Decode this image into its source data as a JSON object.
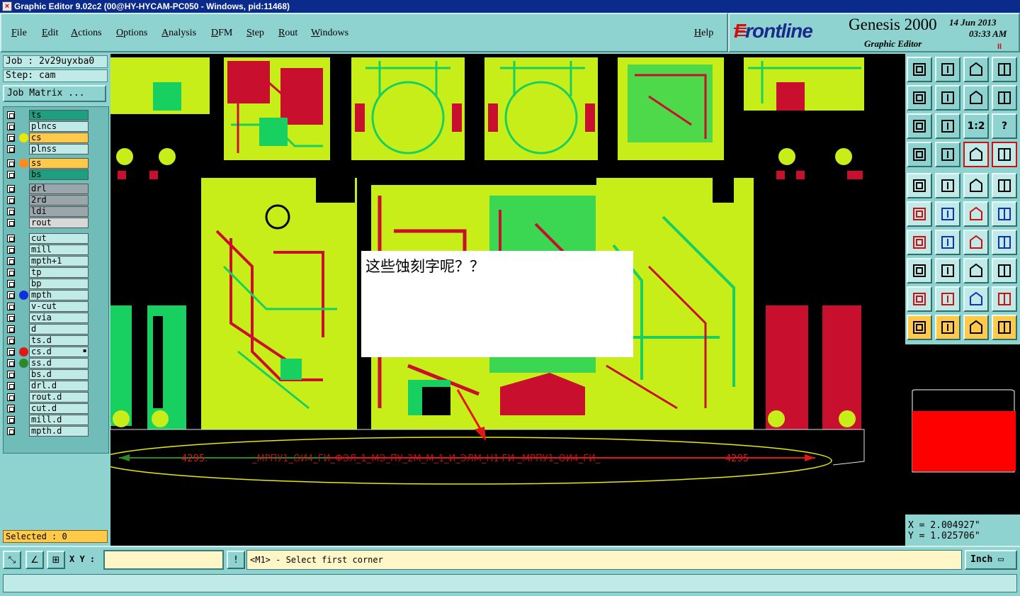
{
  "window": {
    "title": "Graphic Editor 9.02c2 (00@HY-HYCAM-PC050 - Windows, pid:11468)"
  },
  "menu": [
    "File",
    "Edit",
    "Actions",
    "Options",
    "Analysis",
    "DFM",
    "Step",
    "Rout",
    "Windows"
  ],
  "help_label": "Help",
  "brand": {
    "logo": "Frontline",
    "product": "Genesis 2000",
    "subtitle": "Graphic Editor",
    "date": "14 Jun 2013",
    "time": "03:33 AM",
    "pause": "II"
  },
  "job": {
    "job_label": "Job : 2v29uyxba0",
    "step_label": "Step: cam",
    "matrix_button": "Job Matrix ..."
  },
  "layers": [
    {
      "name": "ts",
      "color": "#1f9f82",
      "dot": ""
    },
    {
      "name": "plncs",
      "color": "#bfeae8",
      "dot": ""
    },
    {
      "name": "cs",
      "color": "#ffc94a",
      "dot": "#e8e800"
    },
    {
      "name": "plnss",
      "color": "#bfeae8",
      "dot": ""
    },
    {
      "name": "ss",
      "color": "#ffc94a",
      "dot": "#ff8c1a"
    },
    {
      "name": "bs",
      "color": "#1f9f82",
      "dot": ""
    },
    {
      "name": "drl",
      "color": "#9aa6ac",
      "dot": ""
    },
    {
      "name": "2rd",
      "color": "#9aa6ac",
      "dot": ""
    },
    {
      "name": "ldi",
      "color": "#9aa6ac",
      "dot": ""
    },
    {
      "name": "rout",
      "color": "#d8d8d8",
      "dot": ""
    },
    {
      "name": "cut",
      "color": "#bfeae8",
      "dot": ""
    },
    {
      "name": "mill",
      "color": "#bfeae8",
      "dot": ""
    },
    {
      "name": "mpth+1",
      "color": "#bfeae8",
      "dot": ""
    },
    {
      "name": "tp",
      "color": "#bfeae8",
      "dot": ""
    },
    {
      "name": "bp",
      "color": "#bfeae8",
      "dot": ""
    },
    {
      "name": "mpth",
      "color": "#bfeae8",
      "dot": "#1030e0"
    },
    {
      "name": "v-cut",
      "color": "#bfeae8",
      "dot": ""
    },
    {
      "name": "cvia",
      "color": "#bfeae8",
      "dot": ""
    },
    {
      "name": "d",
      "color": "#bfeae8",
      "dot": ""
    },
    {
      "name": "ts.d",
      "color": "#bfeae8",
      "dot": ""
    },
    {
      "name": "cs.d",
      "color": "#bfeae8",
      "dot": "#e01818",
      "extra": "▪"
    },
    {
      "name": "ss.d",
      "color": "#bfeae8",
      "dot": "#2a8a2a"
    },
    {
      "name": "bs.d",
      "color": "#bfeae8",
      "dot": ""
    },
    {
      "name": "drl.d",
      "color": "#bfeae8",
      "dot": ""
    },
    {
      "name": "rout.d",
      "color": "#bfeae8",
      "dot": ""
    },
    {
      "name": "cut.d",
      "color": "#bfeae8",
      "dot": ""
    },
    {
      "name": "mill.d",
      "color": "#bfeae8",
      "dot": ""
    },
    {
      "name": "mpth.d",
      "color": "#bfeae8",
      "dot": ""
    }
  ],
  "selected_label": "Selected : 0",
  "canvas": {
    "callout_text": "这些蚀刻字呢？？",
    "etched_left": "4295.",
    "etched_right": "4295",
    "etched_mid": "_МРПУ1_ОИ4_ГИ_ФЭЛ_1_МЭ_ПУ_2М_М_1_И_ЭЛМ_Н1 ГИ  _МРПУ1_ОИ4_ГИ_",
    "colors": {
      "board": "#c8ee1a",
      "red_layer": "#c8102e",
      "green_layer": "#18d060",
      "annotation": "#e8e800"
    }
  },
  "coords": {
    "x": "X = 2.004927\"",
    "y": "Y = 1.025706\""
  },
  "status": {
    "xy_label": "X Y :",
    "xy_value": "",
    "prompt": "<M1> - Select first corner",
    "units": "Inch"
  },
  "toolbar_icons": [
    "zoom-home-icon",
    "zoom-back-icon",
    "zoom-in-icon",
    "zoom-fit-icon",
    "pan-left-icon",
    "pan-right-icon",
    "flip-icon",
    "redraw-icon",
    "fit-all-icon",
    "center-icon",
    "ratio-icon",
    "help-icon",
    "snap-icon",
    "grid-icon",
    "layers-display-icon",
    "layers-display-alt-icon",
    "pad-icon",
    "line-icon",
    "surface-icon",
    "circle-icon",
    "connect-icon",
    "cross-icon",
    "measure-icon",
    "measure-alt-icon",
    "angle-icon",
    "slope-icon",
    "arc-icon",
    "text-icon",
    "point-icon",
    "dash-icon",
    "dimension-icon",
    "drill-icon",
    "tri-red-icon",
    "tri-orange-icon",
    "tri-blue-icon",
    "tri-red-alt-icon",
    "select-icon",
    "select-box-icon",
    "select-point-icon",
    "route-select-icon"
  ],
  "toolbar_labels": {
    "ratio": "1:2",
    "help": "?"
  }
}
